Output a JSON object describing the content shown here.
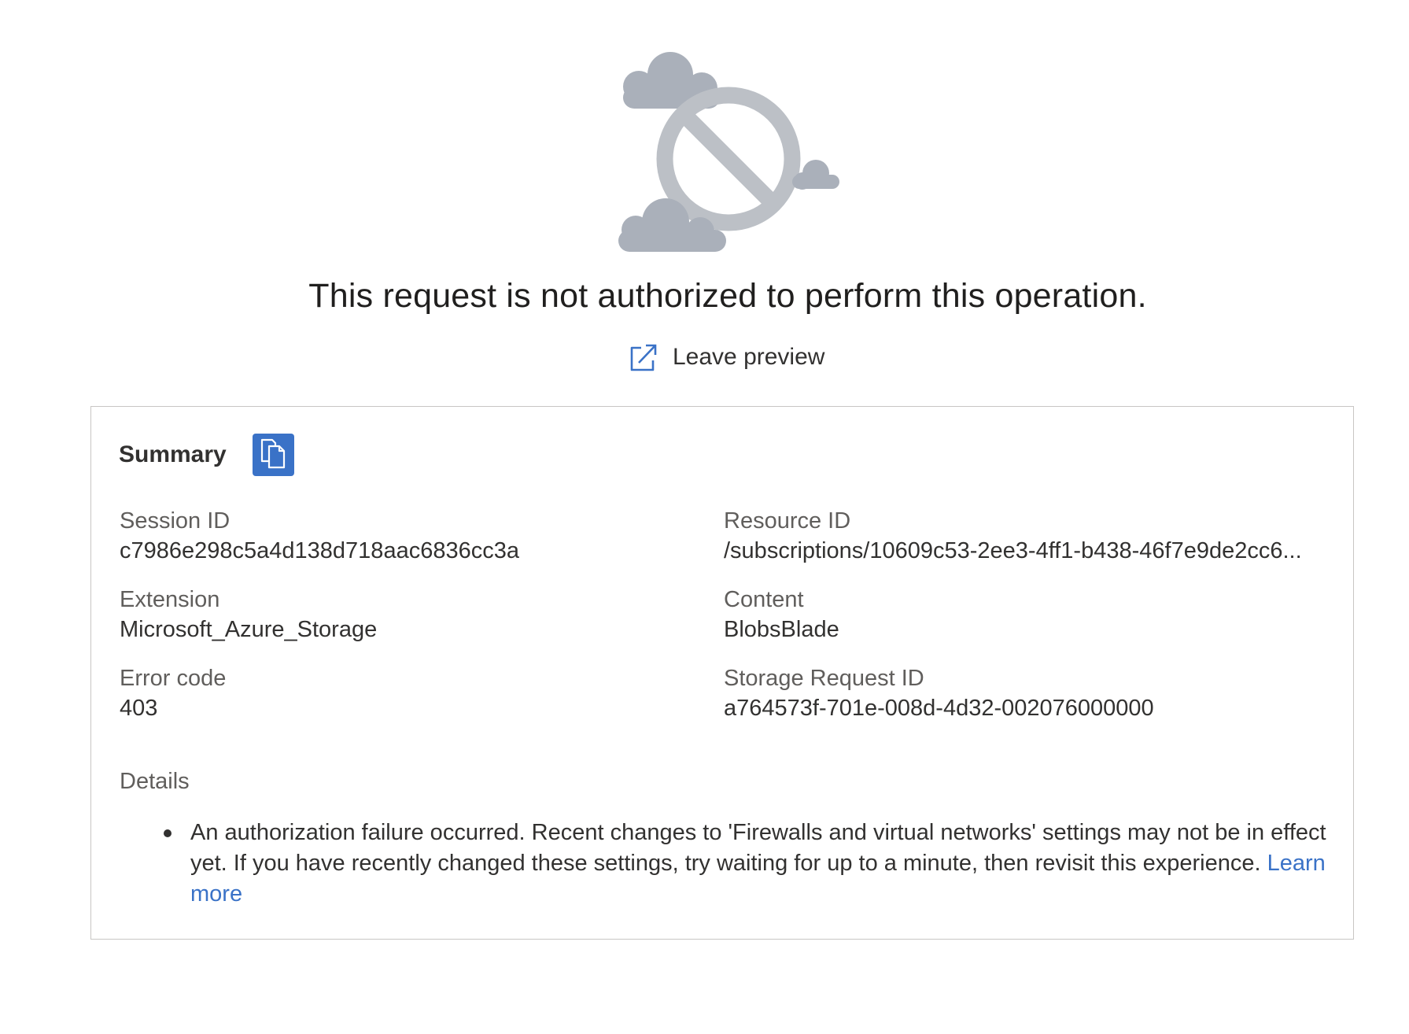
{
  "error": {
    "illustration_icon": "blocked-cloud-icon",
    "headline": "This request is not authorized to perform this operation."
  },
  "leave_preview": {
    "label": "Leave preview",
    "icon": "open-in-new-window-icon"
  },
  "summary": {
    "title": "Summary",
    "copy_icon": "copy-icon",
    "fields": {
      "session_id": {
        "label": "Session ID",
        "value": "c7986e298c5a4d138d718aac6836cc3a"
      },
      "resource_id": {
        "label": "Resource ID",
        "value": "/subscriptions/10609c53-2ee3-4ff1-b438-46f7e9de2cc6..."
      },
      "extension": {
        "label": "Extension",
        "value": "Microsoft_Azure_Storage"
      },
      "content": {
        "label": "Content",
        "value": "BlobsBlade"
      },
      "error_code": {
        "label": "Error code",
        "value": "403"
      },
      "storage_request_id": {
        "label": "Storage Request ID",
        "value": "a764573f-701e-008d-4d32-002076000000"
      }
    },
    "details": {
      "label": "Details",
      "items": [
        {
          "text": "An authorization failure occurred. Recent changes to 'Firewalls and virtual networks' settings may not be in effect yet. If you have recently changed these settings, try waiting for up to a minute, then revisit this experience.",
          "link": "Learn more"
        }
      ]
    }
  },
  "colors": {
    "accent": "#3a72c7",
    "illustration_gray": "#aab0ba",
    "border": "#c8c6c4"
  }
}
